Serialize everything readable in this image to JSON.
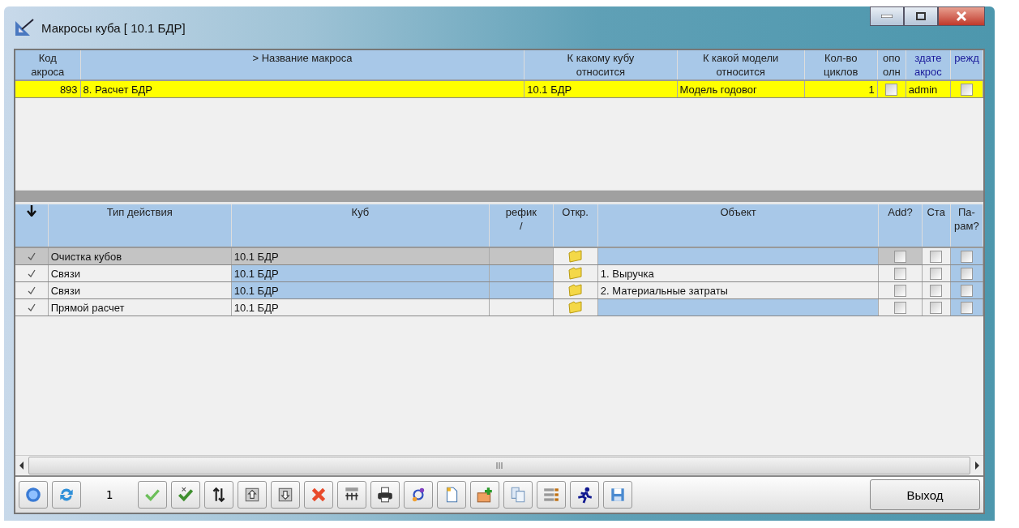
{
  "window": {
    "title": "Макросы куба [ 10.1 БДР]"
  },
  "macros": {
    "columns": [
      "Код\nакроса",
      "> Название макроса",
      "К какому кубу\nотносится",
      "К какой модели\nотносится",
      "Кол-во\nциклов",
      "опо\nолн",
      "здате\nакрос",
      "режд"
    ],
    "rows": [
      {
        "selected": true,
        "code": "893",
        "name": "8. Расчет БДР",
        "cube": "10.1 БДР",
        "model": "Модель годовог",
        "cycles": "1",
        "flag_1": false,
        "author": "admin",
        "flag_2": false
      }
    ]
  },
  "actions": {
    "columns": [
      "Тип действия",
      "Куб",
      "рефик\n/",
      "Откр.",
      "Объект",
      "Add?",
      "Ста",
      "Па-\nрам?"
    ],
    "rows": [
      {
        "enabled": true,
        "selected": true,
        "type": "Очистка кубов",
        "cube": "10.1 БДР",
        "object_highlighted": true,
        "add": false,
        "sta": false,
        "param": false
      },
      {
        "enabled": true,
        "selected": false,
        "type": "Связи",
        "cube": "10.1 БДР",
        "cube_highlighted": true,
        "object": "1. Выручка",
        "object_highlighted": false,
        "add": false,
        "sta": false,
        "param": false
      },
      {
        "enabled": true,
        "selected": false,
        "type": "Связи",
        "cube": "10.1 БДР",
        "cube_highlighted": true,
        "object": "2. Материальные затраты",
        "object_highlighted": false,
        "add": false,
        "sta": false,
        "param": false
      },
      {
        "enabled": true,
        "selected": false,
        "type": "Прямой расчет",
        "cube": "10.1 БДР",
        "cube_highlighted": false,
        "object_highlighted": true,
        "add": false,
        "sta": false,
        "param": false
      }
    ]
  },
  "toolbar": {
    "page": "1",
    "exit_button": "Выход"
  }
}
